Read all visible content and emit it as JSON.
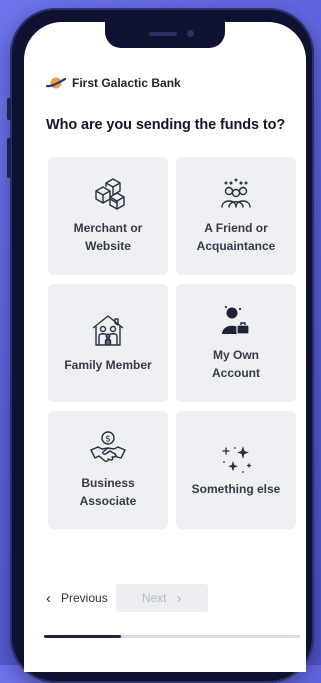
{
  "brand": {
    "name": "First Galactic Bank"
  },
  "question": "Who are you sending the funds to?",
  "options": [
    {
      "label1": "Merchant or",
      "label2": "Website",
      "icon": "boxes-icon"
    },
    {
      "label1": "A Friend or",
      "label2": "Acquaintance",
      "icon": "friends-group-icon"
    },
    {
      "label1": "Family Member",
      "label2": "",
      "icon": "family-house-icon"
    },
    {
      "label1": "My Own",
      "label2": "Account",
      "icon": "person-briefcase-icon"
    },
    {
      "label1": "Business",
      "label2": "Associate",
      "icon": "handshake-icon"
    },
    {
      "label1": "Something else",
      "label2": "",
      "icon": "sparkles-icon"
    }
  ],
  "nav": {
    "previous": "Previous",
    "next": "Next",
    "prev_glyph": "‹",
    "next_glyph": "›"
  },
  "progress": {
    "fraction": 0.3
  },
  "colors": {
    "background": "#5b60d8",
    "card": "#eef0f4",
    "text": "#111827",
    "accent": "#f0a030"
  }
}
